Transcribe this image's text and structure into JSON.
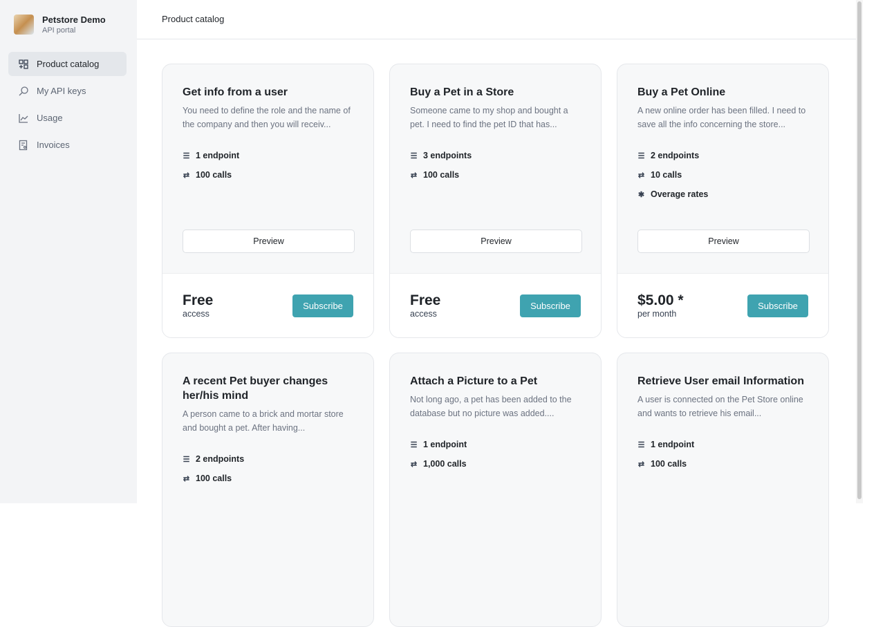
{
  "brand": {
    "name": "Petstore Demo",
    "subtitle": "API portal"
  },
  "nav": [
    {
      "label": "Product catalog",
      "icon": "catalog-icon",
      "active": true
    },
    {
      "label": "My API keys",
      "icon": "key-search-icon"
    },
    {
      "label": "Usage",
      "icon": "chart-icon"
    },
    {
      "label": "Invoices",
      "icon": "invoice-icon"
    }
  ],
  "header": {
    "title": "Product catalog"
  },
  "accent": "#3fa3b0",
  "cards": [
    {
      "title": "Get info from a user",
      "desc": "You need to define the role and the name of the company and then you will receiv...",
      "features": [
        "1 endpoint",
        "100 calls"
      ],
      "preview": "Preview",
      "price": "Free",
      "price_note": "access",
      "subscribe": "Subscribe"
    },
    {
      "title": "Buy a Pet in a Store",
      "desc": "Someone came to my shop and bought a pet. I need to find the pet ID that has...",
      "features": [
        "3 endpoints",
        "100 calls"
      ],
      "preview": "Preview",
      "price": "Free",
      "price_note": "access",
      "subscribe": "Subscribe"
    },
    {
      "title": "Buy a Pet Online",
      "desc": "A new online order has been filled. I need to save all the info concerning the store...",
      "features": [
        "2 endpoints",
        "10 calls",
        "Overage rates"
      ],
      "preview": "Preview",
      "price": "$5.00 *",
      "price_note": "per month",
      "subscribe": "Subscribe"
    },
    {
      "title": "A recent Pet buyer changes her/his mind",
      "desc": "A person came to a brick and mortar store and bought a pet. After having...",
      "features": [
        "2 endpoints",
        "100 calls"
      ]
    },
    {
      "title": "Attach a Picture to a Pet",
      "desc": "Not long ago, a pet has been added to the database but no picture was added....",
      "features": [
        "1 endpoint",
        "1,000 calls"
      ]
    },
    {
      "title": "Retrieve User email Information",
      "desc": "A user is connected on the Pet Store online and wants to retrieve his email...",
      "features": [
        "1 endpoint",
        "100 calls"
      ]
    }
  ]
}
